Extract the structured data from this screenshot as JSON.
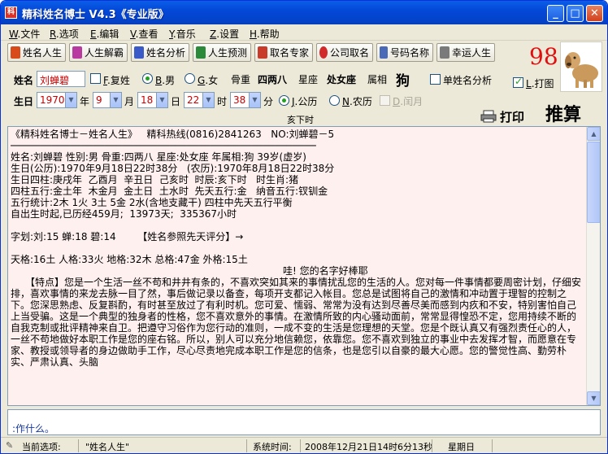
{
  "window": {
    "title": "精科姓名博士  V4.3《专业版》",
    "icon": "app-logo-icon"
  },
  "menu": [
    {
      "key": "W",
      "label": "文件"
    },
    {
      "key": "R",
      "label": "选项"
    },
    {
      "key": "E",
      "label": "编辑"
    },
    {
      "key": "V",
      "label": "查看"
    },
    {
      "key": "Y",
      "label": "音乐"
    },
    {
      "key": "Z",
      "label": "设置"
    },
    {
      "key": "H",
      "label": "帮助"
    }
  ],
  "toolbar": [
    {
      "label": "姓名人生",
      "icon": "name-life-icon"
    },
    {
      "label": "人生解霸",
      "icon": "life-analysis-icon"
    },
    {
      "label": "姓名分析",
      "icon": "name-analysis-icon"
    },
    {
      "label": "人生预测",
      "icon": "life-forecast-icon"
    },
    {
      "label": "取名专家",
      "icon": "naming-expert-icon"
    },
    {
      "label": "公司取名",
      "icon": "company-naming-icon"
    },
    {
      "label": "号码名称",
      "icon": "number-name-icon"
    },
    {
      "label": "幸运人生",
      "icon": "lucky-life-icon"
    }
  ],
  "score": "98",
  "form": {
    "name_label": "姓名",
    "name_value": "刘蝉碧",
    "fuxing_key": "F",
    "fuxing_label": "复姓",
    "male_key": "B",
    "male_label": "男",
    "female_key": "G",
    "female_label": "女",
    "bone_label": "骨重",
    "bone_value": "四两八",
    "star_label": "星座",
    "star_value": "处女座",
    "zodiac_label": "属相",
    "zodiac_value": "狗",
    "single_label": "单姓名分析",
    "print_key": "L",
    "print_label": "打图",
    "birth_label": "生日",
    "year": "1970",
    "year_unit": "年",
    "month": "9",
    "month_unit": "月",
    "day": "18",
    "day_unit": "日",
    "hour": "22",
    "hour_unit": "时",
    "minute": "38",
    "minute_unit": "分",
    "solar_key": "J",
    "solar_label": "公历",
    "lunar_key": "N",
    "lunar_label": "农历",
    "leap_key": "D",
    "leap_label": "闰月",
    "time_zhi": "亥下时",
    "print_button": "打印",
    "calc_button": "推算"
  },
  "content": {
    "line1": "《精科姓名博士－姓名人生》   精科热线(0816)2841263   NO:刘蝉碧－5",
    "line2": "────────────────────────────────────────────────────",
    "line3": "姓名:刘蝉碧 性别:男 骨重:四两八 星座:处女座 年属相:狗 39岁(虚岁)",
    "line4": "生日(公历):1970年9月18日22时38分   (农历):1970年8月18日22时38分",
    "line5": "生日四柱:庚戌年  乙酉月  辛丑日  己亥时  时辰:亥下时   时生肖:猪",
    "line6": "四柱五行:金土年  木金月  金土日  土水时  先天五行:金   纳音五行:钗钏金",
    "line7": "五行统计:2木 1火 3土 5金 2水(含地支藏干) 四柱中先天五行平衡",
    "line8": "自出生时起,已历经459月;  13973天;  335367小时",
    "line9": "字划:刘:15 蝉:18 碧:14       【姓名参照先天评分】→",
    "line10": "天格:16土 人格:33火 地格:32木 总格:47金 外格:15土",
    "line11": "哇! 您的名字好棒耶",
    "para": "　　【特点】您是一个生活一丝不苟和井井有条的，不喜欢突如其来的事情扰乱您的生活的人。您对每一件事情都要周密计划，仔细安排，喜欢事情的来龙去脉一目了然，事后做记录以备查，每项开支都记入帐目。您总是试图将自己的激情和冲动置于理智的控制之下。您深思熟虑、反复斟酌，有时甚至放过了有利时机。您可爱、懦弱、常常为没有达到尽善尽美而感到内疚和不安，特别害怕自己上当受骗。这是一个典型的独身者的性格，您不喜欢意外的事情。在激情所致的内心骚动面前，常常显得惶恐不定，您用持续不断的自我克制或批评精神来自卫。把遵守习俗作为您行动的准则，一成不变的生活是您理想的天堂。您是个既认真又有强烈责任心的人，一丝不苟地做好本职工作是您的座右铭。所以，别人可以充分地信赖您，依靠您。您不喜欢到独立的事业中去发挥才智，而愿意在专家、教授或领导者的身边做助手工作，尽心尽责地完成本职工作是您的信条，也是您引以自豪的最大心愿。您的警觉性高、勤劳朴实、严肃认真、头脑"
  },
  "notes": ":作什么。",
  "status": {
    "current_label": "当前选项:",
    "current_value": "\"姓名人生\"",
    "time_label": "系统时间:",
    "time_value": "2008年12月21日14时6分13秒",
    "weekday": "星期日"
  },
  "colors": {
    "score": "#e01010",
    "content_bg": "#fff0f0",
    "input_text": "#cc0000",
    "titlebar": "#0448d8"
  }
}
